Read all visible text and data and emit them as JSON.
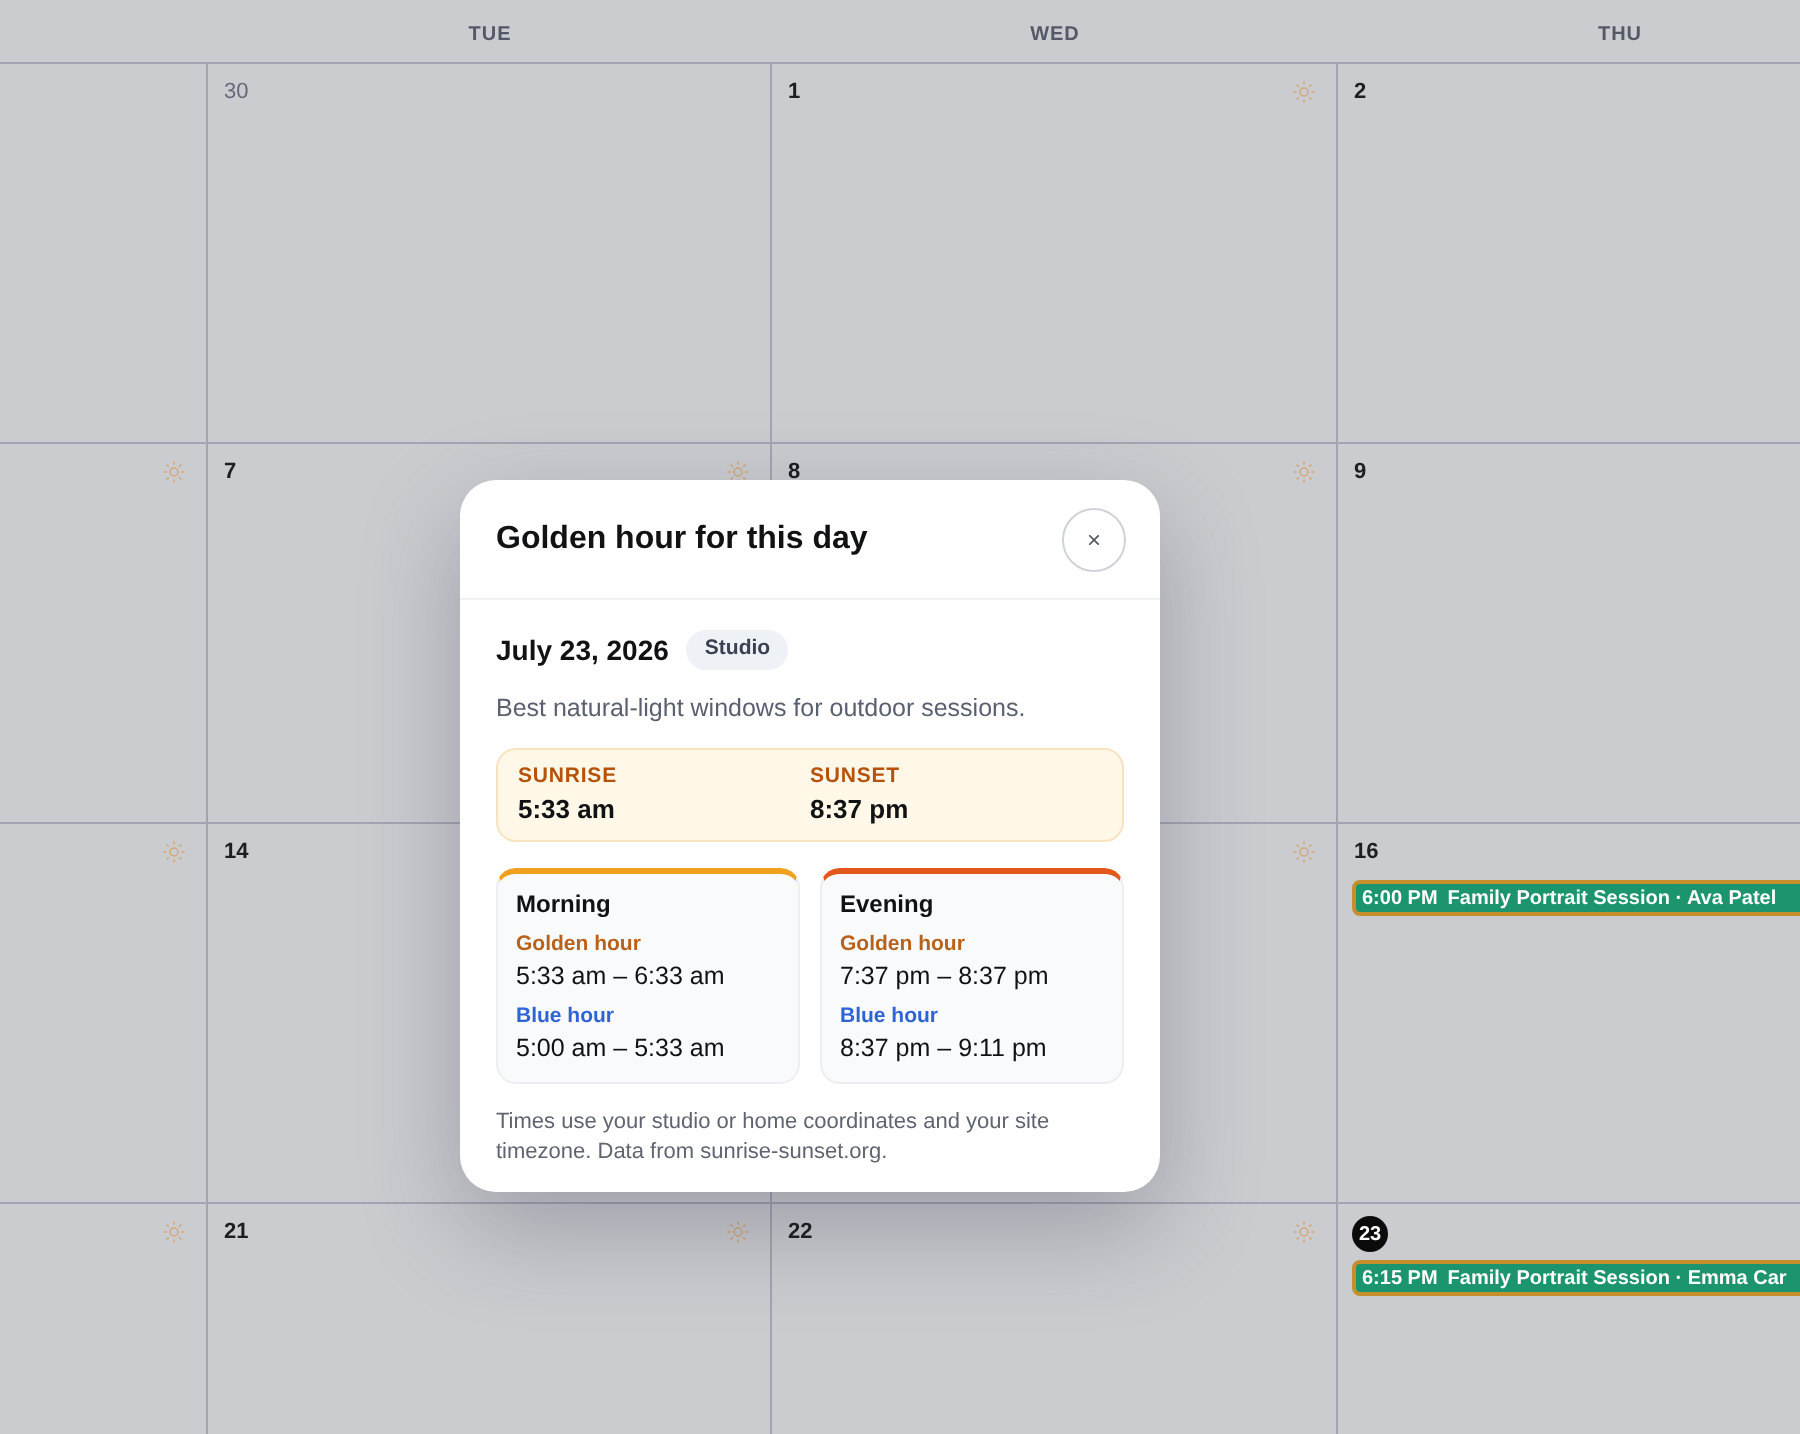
{
  "calendar": {
    "weekday_headers": [
      "TUE",
      "WED",
      "THU"
    ],
    "weeks": [
      {
        "days": [
          {
            "sun_icon": false
          },
          {
            "day": "30",
            "outside_month": true,
            "today": false,
            "sun_icon": false
          },
          {
            "day": "1",
            "outside_month": false,
            "today": false,
            "sun_icon": true
          },
          {
            "day": "2",
            "outside_month": false,
            "today": false
          }
        ]
      },
      {
        "days": [
          {
            "sun_icon": true
          },
          {
            "day": "7",
            "outside_month": false,
            "today": false,
            "sun_icon": true
          },
          {
            "day": "8",
            "outside_month": false,
            "today": false,
            "sun_icon": true
          },
          {
            "day": "9",
            "outside_month": false,
            "today": false
          }
        ]
      },
      {
        "days": [
          {
            "sun_icon": true
          },
          {
            "day": "14",
            "outside_month": false,
            "today": false
          },
          {
            "sun_icon": true
          },
          {
            "day": "16",
            "outside_month": false,
            "today": false,
            "events": [
              {
                "time": "6:00 PM",
                "title": "Family Portrait Session · Ava Patel"
              }
            ]
          }
        ]
      },
      {
        "days": [
          {
            "sun_icon": true
          },
          {
            "day": "21",
            "outside_month": false,
            "today": false,
            "sun_icon": true
          },
          {
            "day": "22",
            "outside_month": false,
            "today": false,
            "sun_icon": true
          },
          {
            "day": "23",
            "outside_month": false,
            "today": true,
            "events": [
              {
                "time": "6:15 PM",
                "title": "Family Portrait Session · Emma Car"
              }
            ]
          }
        ]
      }
    ]
  },
  "dialog": {
    "title": "Golden hour for this day",
    "close_label": "×",
    "date": "July 23, 2026",
    "location_badge": "Studio",
    "description": "Best natural-light windows for outdoor sessions.",
    "sun_times": [
      {
        "label": "SUNRISE",
        "time": "5:33 am"
      },
      {
        "label": "SUNSET",
        "time": "8:37 pm"
      }
    ],
    "periods": [
      {
        "kind": "morning",
        "title": "Morning",
        "windows": [
          {
            "kind": "golden",
            "label": "Golden hour",
            "range": "5:33 am – 6:33 am"
          },
          {
            "kind": "blue",
            "label": "Blue hour",
            "range": "5:00 am – 5:33 am"
          }
        ]
      },
      {
        "kind": "evening",
        "title": "Evening",
        "windows": [
          {
            "kind": "golden",
            "label": "Golden hour",
            "range": "7:37 pm – 8:37 pm"
          },
          {
            "kind": "blue",
            "label": "Blue hour",
            "range": "8:37 pm – 9:11 pm"
          }
        ]
      }
    ],
    "footnote": "Times use your studio or home coordinates and your site timezone. Data from sunrise-sunset.org."
  }
}
